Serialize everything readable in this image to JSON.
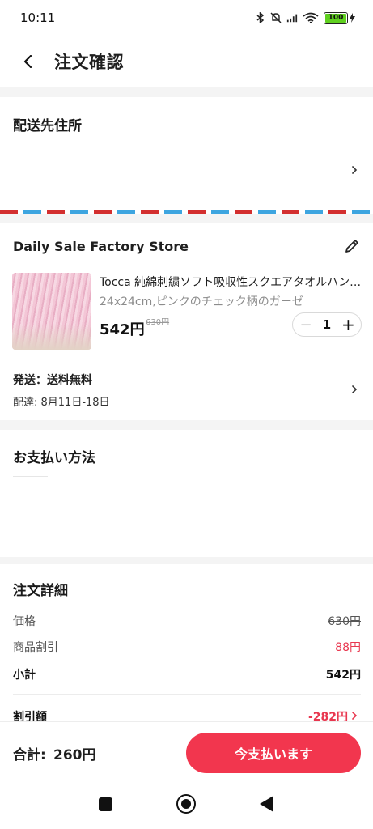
{
  "status_bar": {
    "time": "10:11",
    "battery": "100"
  },
  "header": {
    "title": "注文確認"
  },
  "address": {
    "title": "配送先住所"
  },
  "store": {
    "name": "Daily Sale Factory Store",
    "product": {
      "name": "Tocca 純綿刺繍ソフト吸収性スクエアタオルハンカチ",
      "variant": "24x24cm,ピンクのチェック柄のガーゼ",
      "price": "542円",
      "old_price": "630円",
      "quantity": "1"
    },
    "shipping_label": "発送：送料無料",
    "delivery": "配達: 8月11日-18日"
  },
  "payment": {
    "title": "お支払い方法"
  },
  "details": {
    "title": "注文詳細",
    "rows": [
      {
        "label": "価格",
        "value": "630円"
      },
      {
        "label": "商品割引",
        "value": "88円"
      },
      {
        "label": "小計",
        "value": "542円"
      },
      {
        "label": "割引額",
        "value": "-282円"
      }
    ]
  },
  "footer": {
    "total_label": "合計:",
    "total_value": "260円",
    "pay_button": "今支払います"
  },
  "colors": {
    "accent": "#f2364e",
    "discount_red": "#e8374f"
  }
}
